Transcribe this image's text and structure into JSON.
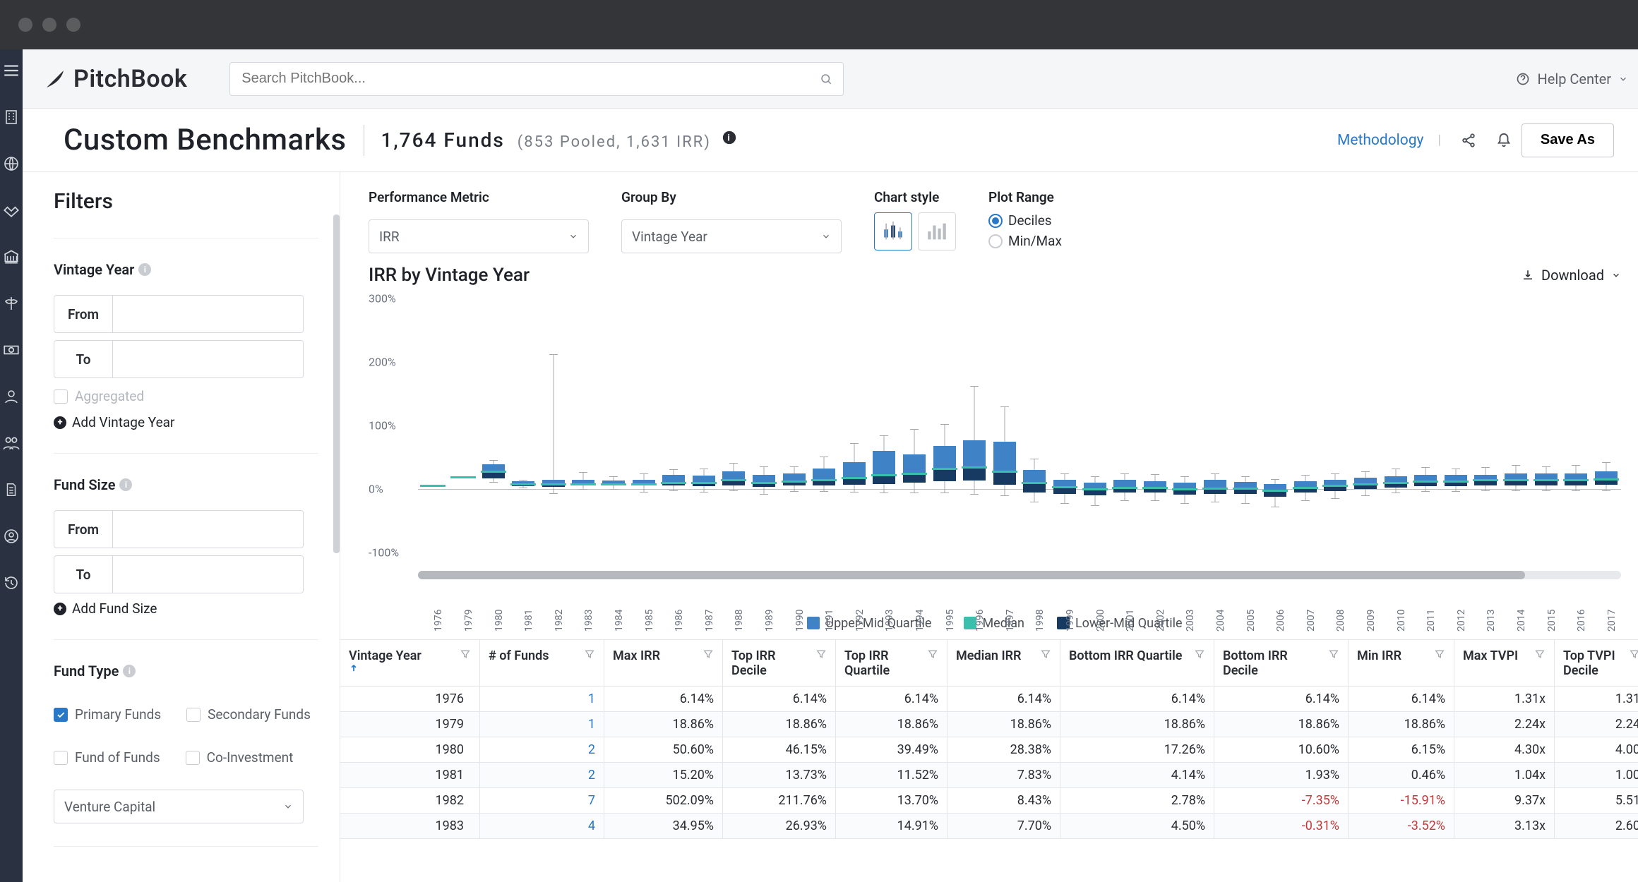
{
  "brand": "PitchBook",
  "search_placeholder": "Search PitchBook...",
  "help_label": "Help Center",
  "page": {
    "title": "Custom Benchmarks",
    "fund_count": "1,764 Funds",
    "fund_breakdown": "(853 Pooled, 1,631 IRR)",
    "methodology": "Methodology",
    "save": "Save As"
  },
  "controls": {
    "perf_metric_label": "Performance Metric",
    "perf_metric_value": "IRR",
    "group_by_label": "Group By",
    "group_by_value": "Vintage Year",
    "chart_style_label": "Chart style",
    "plot_range_label": "Plot Range",
    "plot_range_opts": [
      "Deciles",
      "Min/Max"
    ],
    "plot_range_selected": "Deciles"
  },
  "chart_title": "IRR by Vintage Year",
  "download_label": "Download",
  "legend": {
    "umq": "Upper-Mid Quartile",
    "med": "Median",
    "lmq": "Lower-Mid Quartile"
  },
  "filters": {
    "heading": "Filters",
    "vintage_year_label": "Vintage Year",
    "from_label": "From",
    "to_label": "To",
    "aggregated_label": "Aggregated",
    "add_vintage": "Add Vintage Year",
    "fund_size_label": "Fund Size",
    "add_fund_size": "Add Fund Size",
    "fund_type_label": "Fund Type",
    "fund_type_opts": [
      {
        "label": "Primary Funds",
        "checked": true
      },
      {
        "label": "Secondary Funds",
        "checked": false
      },
      {
        "label": "Fund of Funds",
        "checked": false
      },
      {
        "label": "Co-Investment",
        "checked": false
      }
    ],
    "fund_type_select": "Venture Capital"
  },
  "table": {
    "headers": [
      "Vintage Year",
      "# of Funds",
      "Max IRR",
      "Top IRR Decile",
      "Top IRR Quartile",
      "Median IRR",
      "Bottom IRR Quartile",
      "Bottom IRR Decile",
      "Min IRR",
      "Max TVPI",
      "Top TVPI Decile"
    ],
    "rows": [
      {
        "vy": "1976",
        "nf": "1",
        "max": "6.14%",
        "td": "6.14%",
        "tq": "6.14%",
        "med": "6.14%",
        "bq": "6.14%",
        "bd": "6.14%",
        "bd_neg": false,
        "min": "6.14%",
        "min_neg": false,
        "mtv": "1.31x",
        "ttd": "1.31"
      },
      {
        "vy": "1979",
        "nf": "1",
        "max": "18.86%",
        "td": "18.86%",
        "tq": "18.86%",
        "med": "18.86%",
        "bq": "18.86%",
        "bd": "18.86%",
        "bd_neg": false,
        "min": "18.86%",
        "min_neg": false,
        "mtv": "2.24x",
        "ttd": "2.24"
      },
      {
        "vy": "1980",
        "nf": "2",
        "max": "50.60%",
        "td": "46.15%",
        "tq": "39.49%",
        "med": "28.38%",
        "bq": "17.26%",
        "bd": "10.60%",
        "bd_neg": false,
        "min": "6.15%",
        "min_neg": false,
        "mtv": "4.30x",
        "ttd": "4.00"
      },
      {
        "vy": "1981",
        "nf": "2",
        "max": "15.20%",
        "td": "13.73%",
        "tq": "11.52%",
        "med": "7.83%",
        "bq": "4.14%",
        "bd": "1.93%",
        "bd_neg": false,
        "min": "0.46%",
        "min_neg": false,
        "mtv": "1.04x",
        "ttd": "1.00"
      },
      {
        "vy": "1982",
        "nf": "7",
        "max": "502.09%",
        "td": "211.76%",
        "tq": "13.70%",
        "med": "8.43%",
        "bq": "2.78%",
        "bd": "-7.35%",
        "bd_neg": true,
        "min": "-15.91%",
        "min_neg": true,
        "mtv": "9.37x",
        "ttd": "5.51"
      },
      {
        "vy": "1983",
        "nf": "4",
        "max": "34.95%",
        "td": "26.93%",
        "tq": "14.91%",
        "med": "7.70%",
        "bq": "4.50%",
        "bd": "-0.31%",
        "bd_neg": true,
        "min": "-3.52%",
        "min_neg": true,
        "mtv": "3.13x",
        "ttd": "2.60"
      }
    ]
  },
  "chart_data": {
    "type": "box",
    "ylabel": "IRR",
    "ylim": [
      -100,
      300
    ],
    "yticks": [
      "300%",
      "200%",
      "100%",
      "0%",
      "-100%"
    ],
    "categories": [
      1976,
      1979,
      1980,
      1981,
      1982,
      1983,
      1984,
      1985,
      1986,
      1987,
      1988,
      1989,
      1990,
      1991,
      1992,
      1993,
      1994,
      1995,
      1996,
      1997,
      1998,
      1999,
      2000,
      2001,
      2002,
      2003,
      2004,
      2005,
      2006,
      2007,
      2008,
      2009,
      2010,
      2011,
      2012,
      2013,
      2014,
      2015,
      2016,
      2017
    ],
    "series": [
      {
        "name": "Top IRR Decile",
        "role": "whisker_hi",
        "values": [
          6,
          19,
          46,
          14,
          212,
          27,
          20,
          25,
          31,
          32,
          41,
          36,
          36,
          51,
          72,
          85,
          94,
          102,
          162,
          130,
          48,
          25,
          20,
          24,
          23,
          20,
          25,
          20,
          16,
          22,
          24,
          28,
          32,
          34,
          32,
          34,
          38,
          36,
          38,
          42
        ]
      },
      {
        "name": "Top IRR Quartile",
        "role": "box_hi",
        "values": [
          6,
          19,
          39,
          12,
          14,
          15,
          13,
          14,
          22,
          21,
          28,
          22,
          24,
          32,
          42,
          60,
          55,
          68,
          77,
          74,
          30,
          14,
          10,
          14,
          12,
          10,
          14,
          11,
          8,
          12,
          15,
          18,
          20,
          22,
          22,
          22,
          25,
          24,
          25,
          28
        ]
      },
      {
        "name": "Median IRR",
        "role": "median",
        "values": [
          6,
          19,
          28,
          8,
          8,
          8,
          8,
          8,
          10,
          10,
          14,
          10,
          12,
          14,
          18,
          22,
          25,
          32,
          35,
          28,
          10,
          3,
          0,
          2,
          2,
          0,
          1,
          1,
          -2,
          2,
          6,
          8,
          10,
          12,
          12,
          14,
          15,
          14,
          15,
          16
        ]
      },
      {
        "name": "Bottom IRR Quartile",
        "role": "box_lo",
        "values": [
          6,
          19,
          17,
          4,
          3,
          5,
          5,
          5,
          6,
          4,
          6,
          3,
          6,
          6,
          7,
          8,
          10,
          12,
          13,
          7,
          -5,
          -8,
          -10,
          -6,
          -6,
          -9,
          -8,
          -8,
          -12,
          -6,
          -3,
          0,
          2,
          4,
          4,
          5,
          6,
          5,
          6,
          7
        ]
      },
      {
        "name": "Bottom IRR Decile",
        "role": "whisker_lo",
        "values": [
          6,
          19,
          11,
          2,
          -7,
          0,
          0,
          -4,
          -2,
          -4,
          -2,
          -8,
          -3,
          -3,
          -4,
          -5,
          -6,
          -6,
          -8,
          -10,
          -20,
          -22,
          -25,
          -18,
          -18,
          -22,
          -20,
          -22,
          -28,
          -18,
          -14,
          -10,
          -6,
          -3,
          -3,
          -2,
          -2,
          -2,
          -2,
          -2
        ]
      }
    ]
  }
}
